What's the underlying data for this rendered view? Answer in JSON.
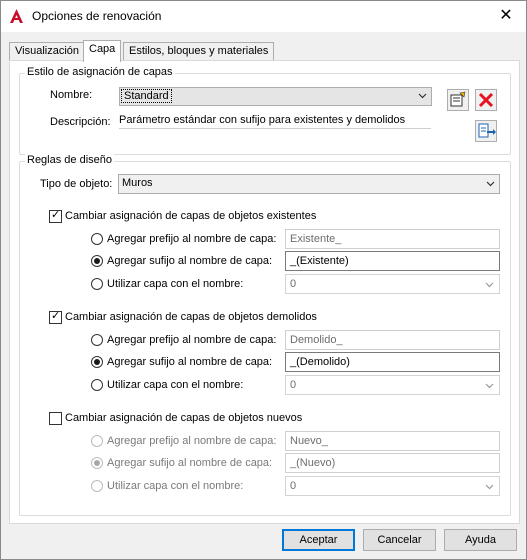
{
  "window": {
    "title": "Opciones de renovación",
    "close": "✕"
  },
  "tabs": [
    {
      "label": "Visualización"
    },
    {
      "label": "Capa"
    },
    {
      "label": "Estilos, bloques y materiales"
    }
  ],
  "layer_style": {
    "group_title": "Estilo de asignación de capas",
    "name_label": "Nombre:",
    "name_value": "Standard",
    "desc_label": "Descripción:",
    "desc_value": "Parámetro estándar con sufijo para existentes y demolidos"
  },
  "design_rules": {
    "group_title": "Reglas de diseño",
    "object_type_label": "Tipo de objeto:",
    "object_type_value": "Muros",
    "sections": [
      {
        "checkbox_label": "Cambiar asignación de capas de objetos existentes",
        "checked": true,
        "prefix_label": "Agregar prefijo al nombre de capa:",
        "prefix_value": "Existente_",
        "suffix_label": "Agregar sufijo al nombre de capa:",
        "suffix_value": "_(Existente)",
        "use_label": "Utilizar capa con el nombre:",
        "use_value": "0"
      },
      {
        "checkbox_label": "Cambiar asignación de capas de objetos demolidos",
        "checked": true,
        "prefix_label": "Agregar prefijo al nombre de capa:",
        "prefix_value": "Demolido_",
        "suffix_label": "Agregar sufijo al nombre de capa:",
        "suffix_value": "_(Demolido)",
        "use_label": "Utilizar capa con el nombre:",
        "use_value": "0"
      },
      {
        "checkbox_label": "Cambiar asignación de capas de objetos nuevos",
        "checked": false,
        "prefix_label": "Agregar prefijo al nombre de capa:",
        "prefix_value": "Nuevo_",
        "suffix_label": "Agregar sufijo al nombre de capa:",
        "suffix_value": "_(Nuevo)",
        "use_label": "Utilizar capa con el nombre:",
        "use_value": "0"
      }
    ]
  },
  "buttons": {
    "accept": "Aceptar",
    "cancel": "Cancelar",
    "help": "Ayuda"
  },
  "colors": {
    "accent": "#0078d7",
    "app_red": "#c8102e",
    "delete_red": "#e81123"
  }
}
